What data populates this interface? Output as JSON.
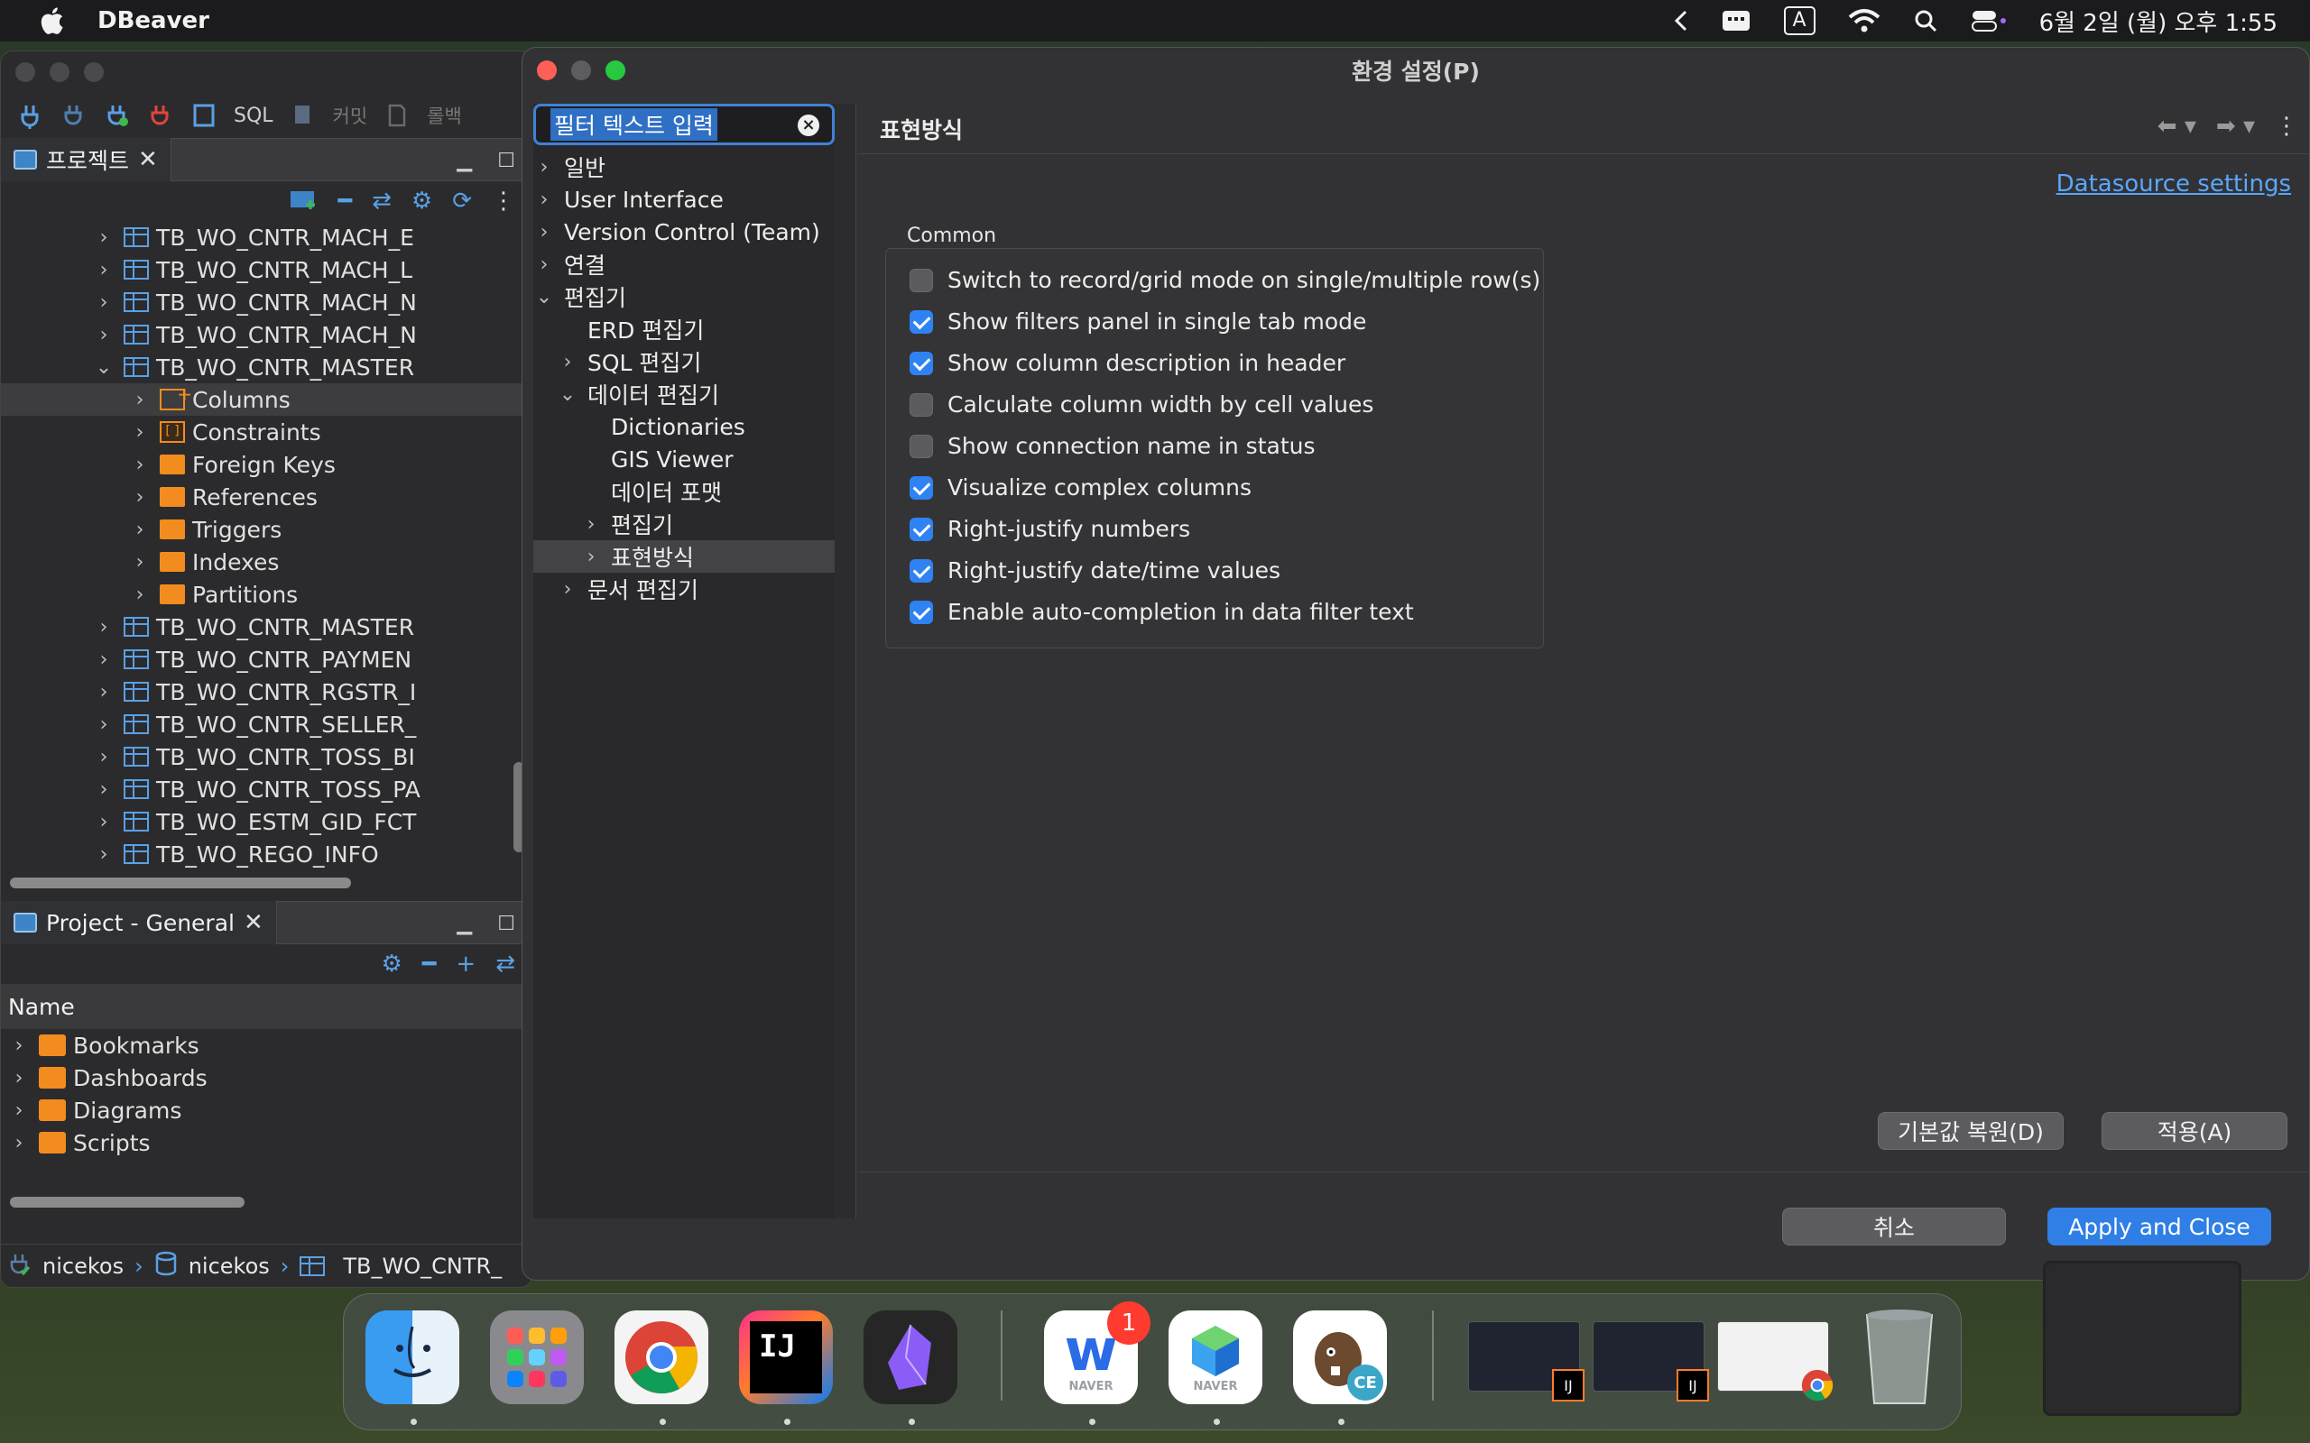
{
  "menubar": {
    "app_name": "DBeaver",
    "input_badge": "A",
    "clock": "6월 2일 (월) 오후 1:55",
    "icons": [
      "apple-logo-icon",
      "chevron-left-icon",
      "menu-extra-icon",
      "input-source-icon",
      "wifi-icon",
      "spotlight-search-icon",
      "control-center-icon"
    ]
  },
  "main": {
    "toolbar": {
      "sql_label": "SQL",
      "commit_label": "커밋",
      "rollback_label": "롤백"
    },
    "projects_panel": {
      "tab_label": "프로젝트",
      "rows": [
        {
          "label": "TB_WO_CNTR_MACH_E",
          "type": "table",
          "indent": 0,
          "expanded": false
        },
        {
          "label": "TB_WO_CNTR_MACH_L",
          "type": "table",
          "indent": 0,
          "expanded": false
        },
        {
          "label": "TB_WO_CNTR_MACH_N",
          "type": "table",
          "indent": 0,
          "expanded": false
        },
        {
          "label": "TB_WO_CNTR_MACH_N",
          "type": "table",
          "indent": 0,
          "expanded": false
        },
        {
          "label": "TB_WO_CNTR_MASTER",
          "type": "table",
          "indent": 0,
          "expanded": true
        },
        {
          "label": "Columns",
          "type": "columns",
          "indent": 1,
          "expanded": false,
          "selected": true
        },
        {
          "label": "Constraints",
          "type": "constraints",
          "indent": 1,
          "expanded": false
        },
        {
          "label": "Foreign Keys",
          "type": "folder",
          "indent": 1,
          "expanded": false
        },
        {
          "label": "References",
          "type": "folder",
          "indent": 1,
          "expanded": false
        },
        {
          "label": "Triggers",
          "type": "folder",
          "indent": 1,
          "expanded": false
        },
        {
          "label": "Indexes",
          "type": "folder",
          "indent": 1,
          "expanded": false
        },
        {
          "label": "Partitions",
          "type": "folder",
          "indent": 1,
          "expanded": false
        },
        {
          "label": "TB_WO_CNTR_MASTER",
          "type": "table",
          "indent": 0,
          "expanded": false
        },
        {
          "label": "TB_WO_CNTR_PAYMEN",
          "type": "table",
          "indent": 0,
          "expanded": false
        },
        {
          "label": "TB_WO_CNTR_RGSTR_I",
          "type": "table",
          "indent": 0,
          "expanded": false
        },
        {
          "label": "TB_WO_CNTR_SELLER_",
          "type": "table",
          "indent": 0,
          "expanded": false
        },
        {
          "label": "TB_WO_CNTR_TOSS_BI",
          "type": "table",
          "indent": 0,
          "expanded": false
        },
        {
          "label": "TB_WO_CNTR_TOSS_PA",
          "type": "table",
          "indent": 0,
          "expanded": false
        },
        {
          "label": "TB_WO_ESTM_GID_FCT",
          "type": "table",
          "indent": 0,
          "expanded": false
        },
        {
          "label": "TB_WO_REGO_INFO",
          "type": "table",
          "indent": 0,
          "expanded": false
        }
      ]
    },
    "general_panel": {
      "tab_label": "Project - General",
      "column_header": "Name",
      "rows": [
        "Bookmarks",
        "Dashboards",
        "Diagrams",
        "Scripts"
      ]
    },
    "statusbar": {
      "crumbs": [
        "nicekos",
        "nicekos",
        "TB_WO_CNTR_"
      ]
    }
  },
  "dialog": {
    "title": "환경 설정(P)",
    "filter_placeholder": "필터 텍스트 입력",
    "nav": [
      {
        "label": "일반",
        "level": 0,
        "chevron": "right"
      },
      {
        "label": "User Interface",
        "level": 0,
        "chevron": "right"
      },
      {
        "label": "Version Control (Team)",
        "level": 0,
        "chevron": "right"
      },
      {
        "label": "연결",
        "level": 0,
        "chevron": "right"
      },
      {
        "label": "편집기",
        "level": 0,
        "chevron": "down"
      },
      {
        "label": "ERD 편집기",
        "level": 1,
        "chevron": "none"
      },
      {
        "label": "SQL 편집기",
        "level": 1,
        "chevron": "right"
      },
      {
        "label": "데이터 편집기",
        "level": 1,
        "chevron": "down"
      },
      {
        "label": "Dictionaries",
        "level": 2,
        "chevron": "none"
      },
      {
        "label": "GIS Viewer",
        "level": 2,
        "chevron": "none"
      },
      {
        "label": "데이터 포맷",
        "level": 2,
        "chevron": "none"
      },
      {
        "label": "편집기",
        "level": 2,
        "chevron": "right"
      },
      {
        "label": "표현방식",
        "level": 2,
        "chevron": "right",
        "selected": true
      },
      {
        "label": "문서 편집기",
        "level": 1,
        "chevron": "right"
      }
    ],
    "page_title": "표현방식",
    "datasource_link": "Datasource settings",
    "group_label": "Common",
    "options": [
      {
        "label": "Switch to record/grid mode on single/multiple row(s)",
        "checked": false
      },
      {
        "label": "Show filters panel in single tab mode",
        "checked": true
      },
      {
        "label": "Show column description in header",
        "checked": true
      },
      {
        "label": "Calculate column width by cell values",
        "checked": false
      },
      {
        "label": "Show connection name in status",
        "checked": false
      },
      {
        "label": "Visualize complex columns",
        "checked": true
      },
      {
        "label": "Right-justify numbers",
        "checked": true
      },
      {
        "label": "Right-justify date/time values",
        "checked": true
      },
      {
        "label": "Enable auto-completion in data filter text",
        "checked": true
      }
    ],
    "restore_defaults_label": "기본값 복원(D)",
    "apply_label": "적용(A)",
    "cancel_label": "취소",
    "apply_close_label": "Apply and Close"
  },
  "dock": {
    "apps": [
      {
        "name": "Finder",
        "icon": "finder-icon"
      },
      {
        "name": "Launchpad",
        "icon": "launchpad-icon"
      },
      {
        "name": "Chrome",
        "icon": "chrome-icon"
      },
      {
        "name": "IntelliJ IDEA",
        "icon": "intellij-icon",
        "text": "IJ"
      },
      {
        "name": "Obsidian",
        "icon": "obsidian-icon"
      },
      {
        "name": "Naver Works",
        "icon": "naver-works-icon",
        "badge": "1",
        "sub": "NAVER"
      },
      {
        "name": "Naver Whale",
        "icon": "naver-whale-icon",
        "sub": "NAVER"
      },
      {
        "name": "DBeaver CE",
        "icon": "dbeaver-icon",
        "sub": "CE"
      }
    ],
    "thumb_labels": [
      "IJ",
      "IJ"
    ],
    "trash_icon": "trash-icon"
  },
  "colors": {
    "accent": "#2f7fe6",
    "link": "#5aa7ff",
    "folder": "#f28c1e"
  }
}
